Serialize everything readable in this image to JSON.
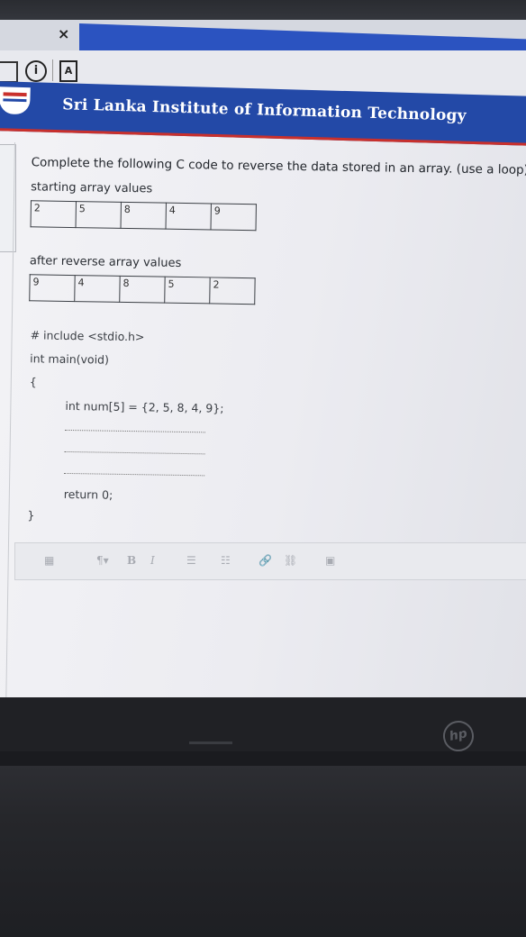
{
  "browser": {
    "tab_close": "×",
    "info_icon_glyph": "i",
    "doc_icon_glyph": "A"
  },
  "banner": {
    "title": "Sri Lanka Institute of Information Technology"
  },
  "question": {
    "text": "Complete the following C code to reverse the data stored in an array. (use a loop)",
    "start_label": "starting array values",
    "start_values": [
      "2",
      "5",
      "8",
      "4",
      "9"
    ],
    "after_label": "after reverse array values",
    "after_values": [
      "9",
      "4",
      "8",
      "5",
      "2"
    ]
  },
  "code": {
    "line1": "# include <stdio.h>",
    "line2": "int main(void)",
    "open_brace": "{",
    "decl": "int num[5] = {2, 5, 8, 4, 9};",
    "ret": "return 0;",
    "close_brace": "}"
  },
  "editor_toolbar": {
    "paragraph": "¶▾",
    "bold": "B",
    "italic": "I",
    "ul": "☰",
    "ol": "☷",
    "link": "🔗",
    "unlink": "⛓",
    "image": "▣"
  },
  "laptop": {
    "brand": "hp"
  }
}
